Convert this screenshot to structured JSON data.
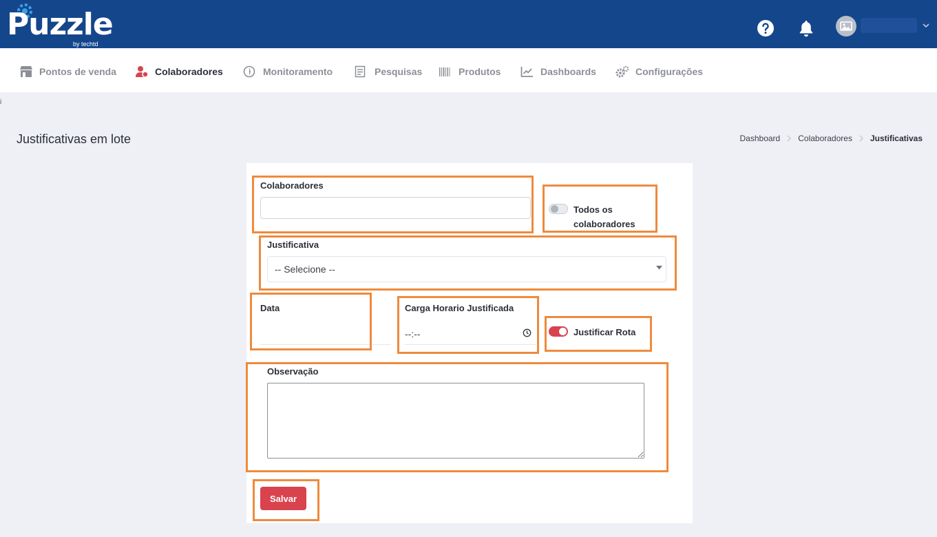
{
  "header": {
    "logo_text": "Puzzle",
    "logo_sub": "by techtd",
    "help_icon": "help-circle-icon",
    "bell_icon": "bell-icon",
    "avatar_icon": "image-placeholder-icon"
  },
  "nav": {
    "items": [
      {
        "label": "Pontos de venda",
        "icon": "store-icon"
      },
      {
        "label": "Colaboradores",
        "icon": "users-icon",
        "active": true
      },
      {
        "label": "Monitoramento",
        "icon": "compass-icon"
      },
      {
        "label": "Pesquisas",
        "icon": "survey-icon"
      },
      {
        "label": "Produtos",
        "icon": "barcode-icon"
      },
      {
        "label": "Dashboards",
        "icon": "chart-line-icon"
      },
      {
        "label": "Configurações",
        "icon": "gears-icon"
      }
    ]
  },
  "page": {
    "title": "Justificativas em lote",
    "stray_mark": "i",
    "breadcrumb": [
      "Dashboard",
      "Colaboradores",
      "Justificativas"
    ]
  },
  "form": {
    "colaboradores_label": "Colaboradores",
    "colaboradores_value": "",
    "todos_label_line1": "Todos os",
    "todos_label_line2": "colaboradores",
    "todos_checked": false,
    "justificativa_label": "Justificativa",
    "justificativa_selected": "-- Selecione --",
    "data_label": "Data",
    "carga_label": "Carga Horario Justificada",
    "carga_value": "--:--",
    "justificar_rota_label": "Justificar Rota",
    "justificar_rota_checked": true,
    "observacao_label": "Observação",
    "observacao_value": "",
    "save_label": "Salvar"
  },
  "colors": {
    "header_bg": "#14468c",
    "accent_red": "#d9434d",
    "annotation_orange": "#ef8a3c"
  }
}
